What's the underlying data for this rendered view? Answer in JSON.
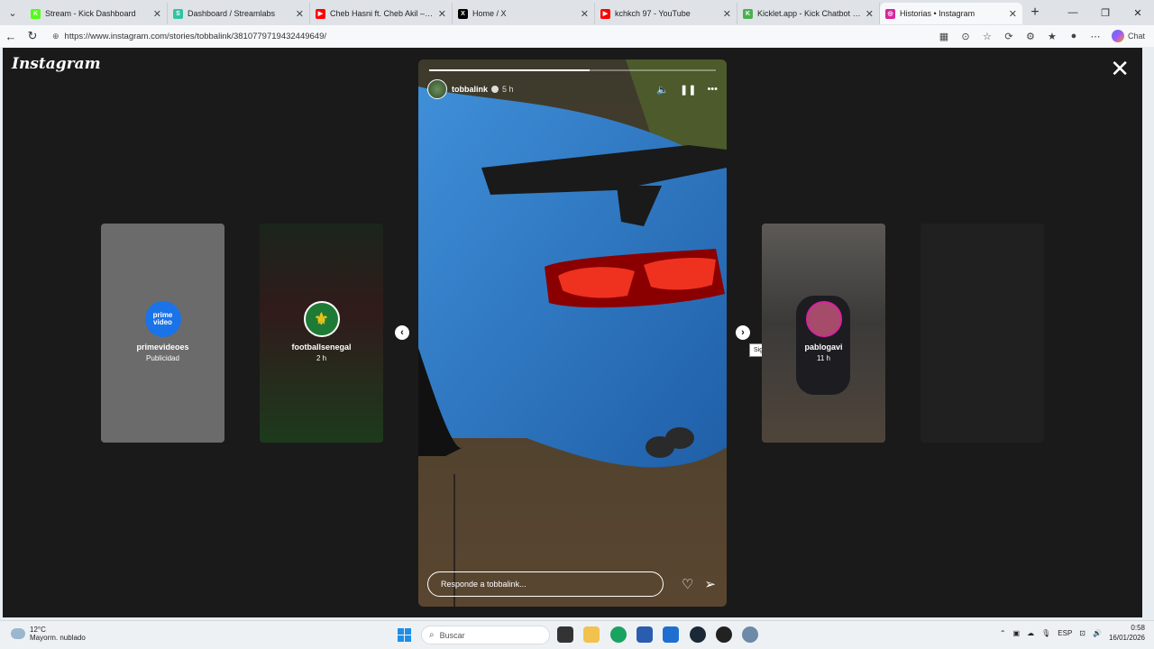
{
  "browser": {
    "tabs": [
      {
        "label": "Stream - Kick Dashboard",
        "fav_color": "#53fc18",
        "fav_glyph": "K"
      },
      {
        "label": "Dashboard / Streamlabs",
        "fav_color": "#31c3a2",
        "fav_glyph": "S"
      },
      {
        "label": "Cheb Hasni ft. Cheb Akil – Sentimo",
        "fav_color": "#ff0000",
        "fav_glyph": "▶"
      },
      {
        "label": "Home / X",
        "fav_color": "#000000",
        "fav_glyph": "X"
      },
      {
        "label": "kchkch 97 - YouTube",
        "fav_color": "#ff0000",
        "fav_glyph": "▶"
      },
      {
        "label": "Kicklet.app - Kick Chatbot and Ov",
        "fav_color": "#4caf50",
        "fav_glyph": "K"
      },
      {
        "label": "Historias • Instagram",
        "fav_color": "#d6249f",
        "fav_glyph": "◎",
        "active": true
      }
    ],
    "url": "https://www.instagram.com/stories/tobbalink/3810779719432449649/",
    "chat_label": "Chat"
  },
  "instagram": {
    "logo": "Instagram",
    "previews": [
      {
        "name": "primevideoes",
        "sub": "Publicidad",
        "avatar_text": "prime video",
        "avatar_color": "#1a73e8",
        "bg": "#6b6b6b"
      },
      {
        "name": "footballsenegal",
        "sub": "2 h",
        "avatar_text": "⚜",
        "avatar_color": "#1f7a35",
        "bg": "#3d5a3a"
      },
      {
        "name": "pablogavi",
        "sub": "11 h",
        "avatar_text": "",
        "avatar_color": "#a64b6a",
        "bg": "#8a8278"
      }
    ],
    "story": {
      "username": "tobbalink",
      "time": "5 h",
      "progress": 0.56,
      "reply_placeholder": "Responde a tobbalink..."
    },
    "next_tooltip": "Siguiente"
  },
  "taskbar": {
    "weather_temp": "12°C",
    "weather_desc": "Mayorm. nublado",
    "search_placeholder": "Buscar",
    "language": "ESP",
    "time": "0:58",
    "date": "16/01/2026"
  }
}
